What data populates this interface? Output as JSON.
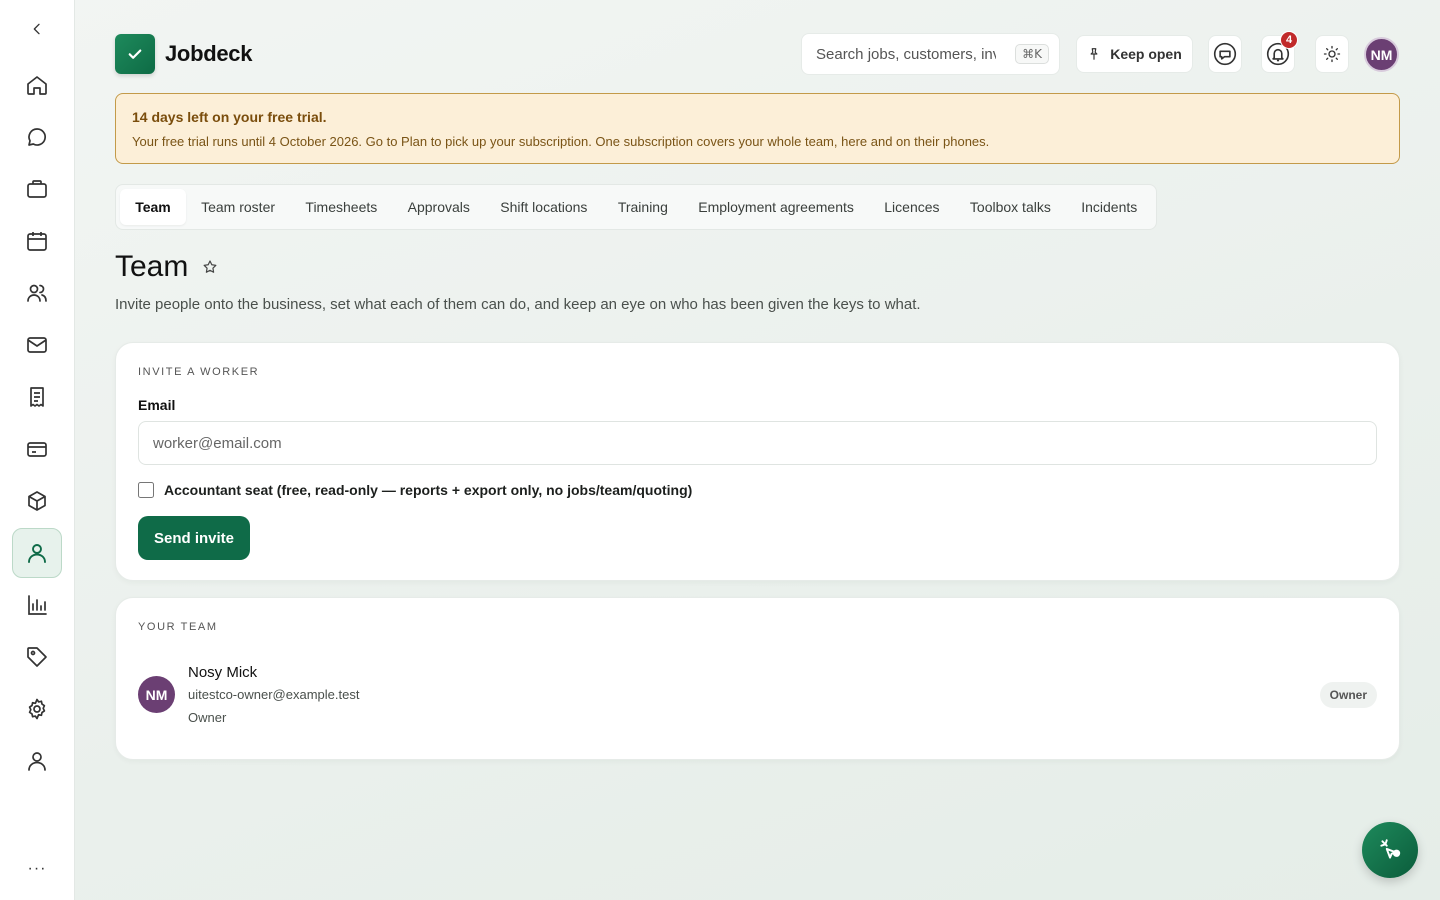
{
  "brand": {
    "name": "Jobdeck"
  },
  "header": {
    "search_placeholder": "Search jobs, customers, invoices",
    "search_shortcut": "⌘K",
    "keep_open_label": "Keep open",
    "notification_count": "4",
    "user_initials": "NM"
  },
  "trial": {
    "title": "14 days left on your free trial.",
    "text": "Your free trial runs until 4 October 2026. Go to Plan to pick up your subscription. One subscription covers your whole team, here and on their phones."
  },
  "tabs": [
    "Team",
    "Team roster",
    "Timesheets",
    "Approvals",
    "Shift locations",
    "Training",
    "Employment agreements",
    "Licences",
    "Toolbox talks",
    "Incidents"
  ],
  "page": {
    "title": "Team",
    "description": "Invite people onto the business, set what each of them can do, and keep an eye on who has been given the keys to what."
  },
  "invite": {
    "section_label": "INVITE A WORKER",
    "email_label": "Email",
    "email_placeholder": "worker@email.com",
    "accountant_label": "Accountant seat (free, read-only — reports + export only, no jobs/team/quoting)",
    "send_label": "Send invite"
  },
  "team": {
    "section_label": "YOUR TEAM",
    "members": [
      {
        "initials": "NM",
        "name": "Nosy Mick",
        "email": "uitestco-owner@example.test",
        "role": "Owner",
        "badge": "Owner"
      }
    ]
  },
  "sidebar": {
    "more_label": "···",
    "icons": [
      "chevron-left-icon",
      "home-icon",
      "chat-icon",
      "briefcase-icon",
      "calendar-icon",
      "users-icon",
      "mail-icon",
      "receipt-icon",
      "card-icon",
      "box-icon",
      "person-icon",
      "chart-icon",
      "tag-icon",
      "gear-icon",
      "profile-icon"
    ]
  },
  "colors": {
    "accent": "#0f6b48",
    "avatar": "#6b3f73",
    "banner_bg": "#fcefd8",
    "badge_red": "#c12a2a"
  }
}
